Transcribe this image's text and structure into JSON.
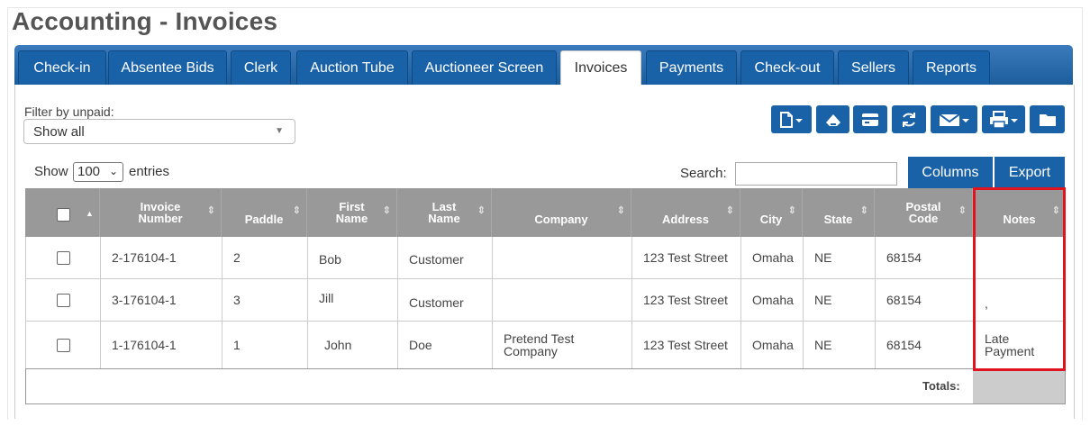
{
  "page": {
    "title": "Accounting - Invoices"
  },
  "tabs": [
    {
      "label": "Check-in",
      "active": false
    },
    {
      "label": "Absentee Bids",
      "active": false
    },
    {
      "label": "Clerk",
      "active": false
    },
    {
      "label": "Auction Tube",
      "active": false
    },
    {
      "label": "Auctioneer Screen",
      "active": false
    },
    {
      "label": "Invoices",
      "active": true
    },
    {
      "label": "Payments",
      "active": false
    },
    {
      "label": "Check-out",
      "active": false
    },
    {
      "label": "Sellers",
      "active": false
    },
    {
      "label": "Reports",
      "active": false
    }
  ],
  "filter": {
    "label": "Filter by unpaid:",
    "value": "Show all"
  },
  "toolbar_icons": [
    "new-document-dropdown-icon",
    "eraser-icon",
    "credit-card-icon",
    "refresh-icon",
    "email-dropdown-icon",
    "print-dropdown-icon",
    "folder-icon"
  ],
  "table_controls": {
    "show_label": "Show",
    "page_size": "100",
    "entries_label": "entries",
    "search_label": "Search:",
    "search_value": "",
    "columns_label": "Columns",
    "export_label": "Export"
  },
  "table": {
    "headers": [
      {
        "line1": "",
        "line2": ""
      },
      {
        "line1": "Invoice",
        "line2": "Number"
      },
      {
        "line1": "",
        "line2": "Paddle"
      },
      {
        "line1": "First",
        "line2": "Name"
      },
      {
        "line1": "Last",
        "line2": "Name"
      },
      {
        "line1": "",
        "line2": "Company"
      },
      {
        "line1": "",
        "line2": "Address"
      },
      {
        "line1": "",
        "line2": "City"
      },
      {
        "line1": "",
        "line2": "State"
      },
      {
        "line1": "Postal",
        "line2": "Code"
      },
      {
        "line1": "",
        "line2": "Notes"
      }
    ],
    "rows": [
      {
        "invoice": "2-176104-1",
        "paddle": "2",
        "first": "Bob",
        "last": "Customer",
        "company": "",
        "address": "123 Test Street",
        "city": "Omaha",
        "state": "NE",
        "postal": "68154",
        "notes": ""
      },
      {
        "invoice": "3-176104-1",
        "paddle": "3",
        "first": "Jill",
        "last": "Customer",
        "company": "",
        "address": "123 Test Street",
        "city": "Omaha",
        "state": "NE",
        "postal": "68154",
        "notes": ","
      },
      {
        "invoice": "1-176104-1",
        "paddle": "1",
        "first": "John",
        "last": "Doe",
        "company": "Pretend Test Company",
        "address": "123 Test Street",
        "city": "Omaha",
        "state": "NE",
        "postal": "68154",
        "notes": "Late Payment"
      }
    ],
    "totals_label": "Totals:"
  },
  "colors": {
    "primary": "#1a62a8",
    "header_bg": "#999999",
    "highlight": "#e0141e"
  }
}
